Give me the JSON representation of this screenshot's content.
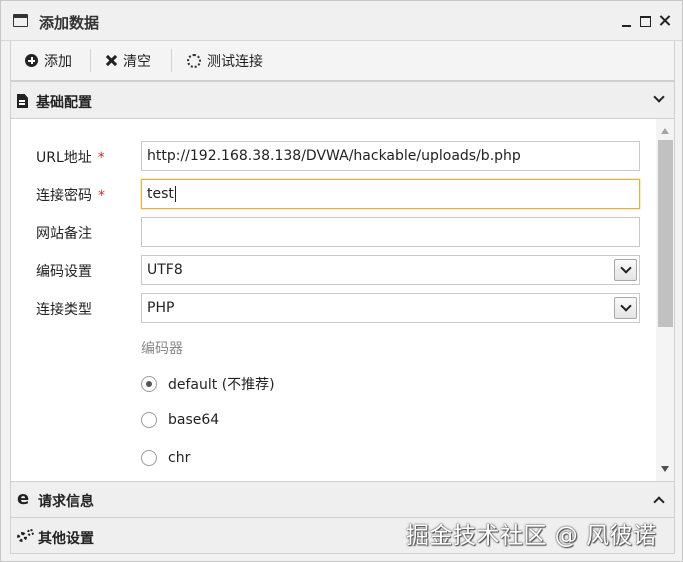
{
  "window": {
    "title": "添加数据"
  },
  "toolbar": {
    "add_label": "添加",
    "clear_label": "清空",
    "test_label": "测试连接"
  },
  "sections": {
    "basic": {
      "label": "基础配置"
    },
    "request": {
      "label": "请求信息"
    },
    "other": {
      "label": "其他设置"
    }
  },
  "form": {
    "url": {
      "label": "URL地址",
      "required_mark": "*",
      "value": "http://192.168.38.138/DVWA/hackable/uploads/b.php"
    },
    "password": {
      "label": "连接密码",
      "required_mark": "*",
      "value": "test"
    },
    "note": {
      "label": "网站备注",
      "value": ""
    },
    "encoding": {
      "label": "编码设置",
      "value": "UTF8"
    },
    "conn_type": {
      "label": "连接类型",
      "value": "PHP"
    },
    "encoder": {
      "label": "编码器",
      "options": [
        {
          "label": "default (不推荐)",
          "checked": true
        },
        {
          "label": "base64",
          "checked": false
        },
        {
          "label": "chr",
          "checked": false
        }
      ]
    }
  },
  "watermark": "掘金技术社区 @ 风彼诺"
}
